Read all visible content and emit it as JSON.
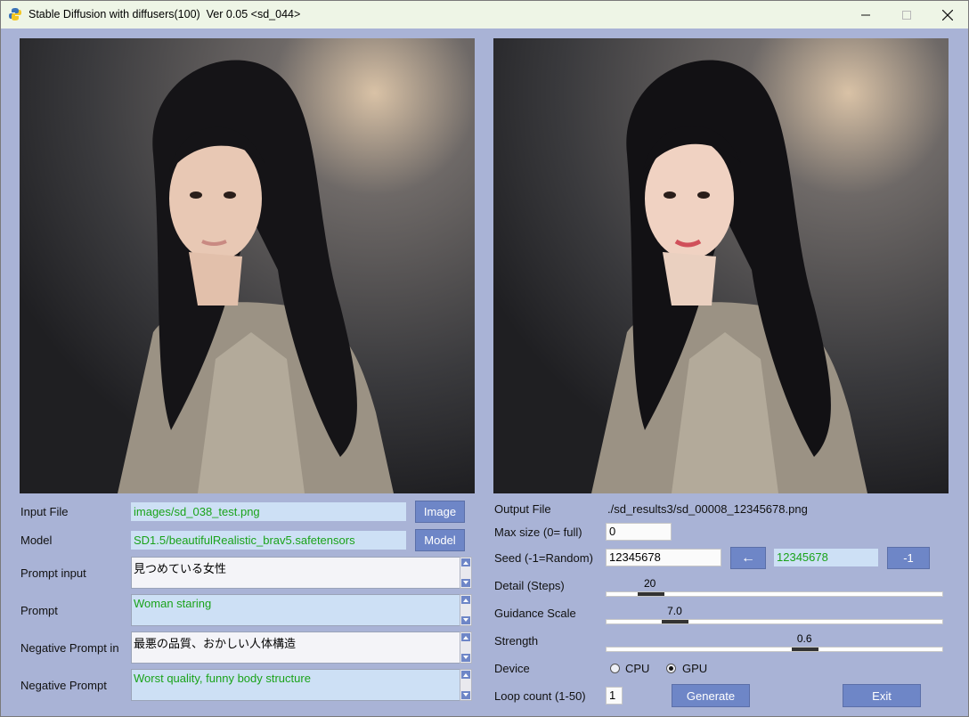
{
  "window": {
    "title": "Stable Diffusion with diffusers(100)  Ver 0.05 <sd_044>"
  },
  "left": {
    "input_file_label": "Input File",
    "input_file_value": "images/sd_038_test.png",
    "image_button": "Image",
    "model_label": "Model",
    "model_value": "SD1.5/beautifulRealistic_brav5.safetensors",
    "model_button": "Model",
    "prompt_input_label": "Prompt input",
    "prompt_input_value": "見つめている女性",
    "prompt_label": "Prompt",
    "prompt_value": "Woman staring",
    "neg_prompt_in_label": "Negative Prompt in",
    "neg_prompt_in_value": "最悪の品質、おかしい人体構造",
    "neg_prompt_label": "Negative Prompt",
    "neg_prompt_value": "Worst quality, funny body structure"
  },
  "right": {
    "output_file_label": "Output File",
    "output_file_value": "./sd_results3/sd_00008_12345678.png",
    "max_size_label": "Max size (0= full)",
    "max_size_value": "0",
    "seed_label": "Seed  (-1=Random)",
    "seed_value": "12345678",
    "seed_arrow_button": "←",
    "seed_last_value": "12345678",
    "seed_minus_button": "-1",
    "steps_label": "Detail (Steps)",
    "steps_value": "20",
    "steps_level": 0.1,
    "guidance_label": "Guidance Scale",
    "guidance_value": "7.0",
    "guidance_level": 0.18,
    "strength_label": "Strength",
    "strength_value": "0.6",
    "strength_level": 0.6,
    "device_label": "Device",
    "device_cpu": "CPU",
    "device_gpu": "GPU",
    "device_selected": "GPU",
    "loop_label": "Loop count (1-50)",
    "loop_value": "1",
    "generate_button": "Generate",
    "exit_button": "Exit"
  },
  "colors": {
    "background": "#a9b3d6",
    "button": "#6e86c7",
    "field_blue": "#cde0f5",
    "field_text_green": "#1aa31a"
  }
}
